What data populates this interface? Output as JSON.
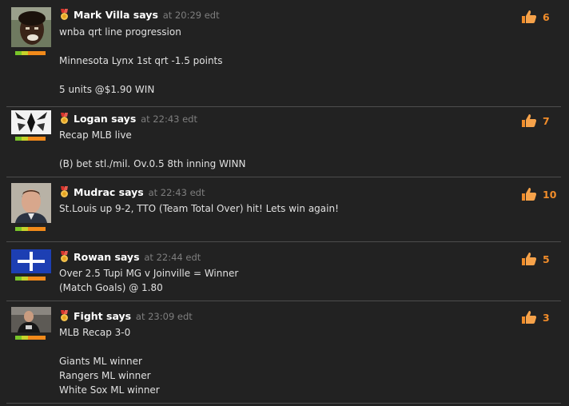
{
  "comments": [
    {
      "author": "Mark Villa says",
      "time": "at 20:29 edt",
      "likes": "6",
      "lines": [
        "wnba qrt line progression",
        "",
        "Minnesota Lynx 1st qrt -1.5 points",
        "",
        "5 units @$1.90 WIN"
      ]
    },
    {
      "author": "Logan says",
      "time": "at 22:43 edt",
      "likes": "7",
      "lines": [
        "Recap MLB live",
        "",
        "(B) bet stl./mil. Ov.0.5 8th inning WINN"
      ]
    },
    {
      "author": "Mudrac says",
      "time": "at 22:43 edt",
      "likes": "10",
      "lines": [
        "St.Louis up 9-2, TTO (Team Total Over) hit! Lets win again!"
      ]
    },
    {
      "author": "Rowan says",
      "time": "at 22:44 edt",
      "likes": "5",
      "lines": [
        "Over 2.5 Tupi MG v Joinville = Winner",
        "(Match Goals) @ 1.80"
      ]
    },
    {
      "author": "Fight says",
      "time": "at 23:09 edt",
      "likes": "3",
      "lines": [
        "MLB Recap 3-0",
        "",
        "Giants ML winner",
        "Rangers ML winner",
        "White Sox ML winner"
      ]
    }
  ],
  "icons": {
    "rank": "medal-icon",
    "like": "thumbs-up-icon"
  },
  "colors": {
    "background": "#222222",
    "likes": "#f08c2a",
    "timestamp": "#7e7e7e",
    "separator": "#4d4d4d"
  }
}
